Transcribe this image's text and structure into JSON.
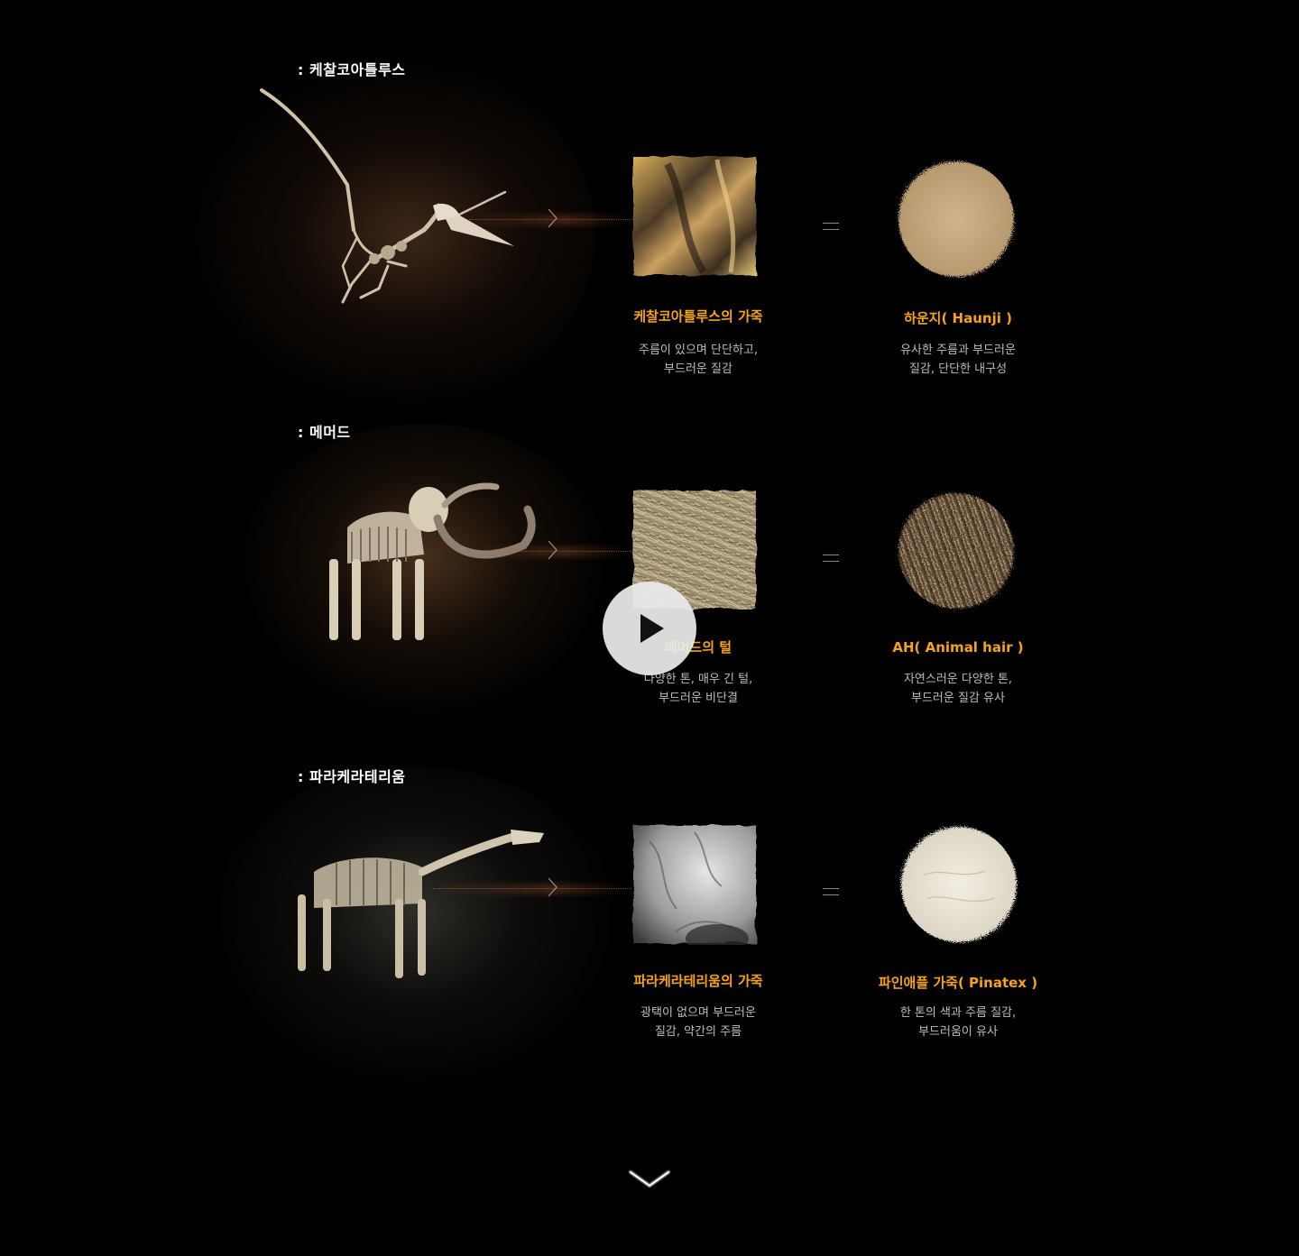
{
  "sections": [
    {
      "title": ": 케찰코아틀루스",
      "left_material": {
        "title": "케찰코아틀루스의 가죽",
        "desc": "주름이 있으며 단단하고,\n부드러운 질감"
      },
      "right_material": {
        "title": "하운지( Haunji )",
        "desc": "유사한 주름과 부드러운\n질감, 단단한 내구성"
      }
    },
    {
      "title": ": 메머드",
      "left_material": {
        "title": "메머드의 털",
        "desc": "다양한 톤, 매우 긴 털,\n부드러운 비단결"
      },
      "right_material": {
        "title": "AH( Animal hair )",
        "desc": "자연스러운 다양한 톤,\n부드러운 질감 유사"
      }
    },
    {
      "title": ": 파라케라테리움",
      "left_material": {
        "title": "파라케라테리움의 가죽",
        "desc": "광택이 없으며 부드러운\n질감, 약간의 주름"
      },
      "right_material": {
        "title": "파인애플 가죽( Pinatex )",
        "desc": "한 톤의 색과 주름 질감,\n부드러움이 유사"
      }
    }
  ],
  "icons": {
    "play": "play-icon",
    "scroll": "chevron-down-icon",
    "connector": "chevron-right-icon",
    "equals": "equals-icon"
  },
  "colors": {
    "background": "#000000",
    "accent": "#f7a314",
    "text": "#ffffff",
    "muted": "#bdbdbd"
  }
}
